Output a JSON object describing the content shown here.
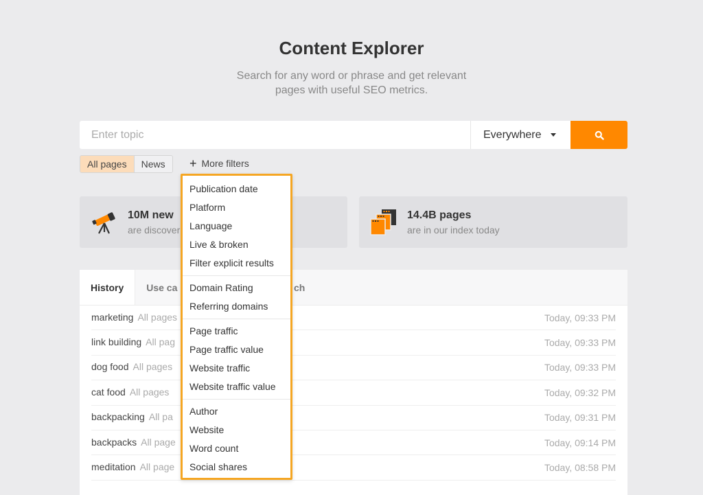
{
  "header": {
    "title": "Content Explorer",
    "subtitle_line1": "Search for any word or phrase and get relevant",
    "subtitle_line2": "pages with useful SEO metrics."
  },
  "search": {
    "placeholder": "Enter topic",
    "scope": "Everywhere",
    "button_icon": "search-icon",
    "button_color": "#ff8800"
  },
  "page_tabs": [
    "All pages",
    "News"
  ],
  "more_filters_label": "More filters",
  "stats": {
    "left": {
      "title": "10M new",
      "subtitle": "are discover",
      "icon": "telescope-icon"
    },
    "right": {
      "title": "14.4B pages",
      "subtitle": "are in our index today",
      "icon": "pages-stack-icon"
    }
  },
  "history": {
    "tabs": [
      "History",
      "Use ca",
      "ch"
    ],
    "rows": [
      {
        "query": "marketing",
        "scope": "All pages",
        "time": "Today, 09:33 PM"
      },
      {
        "query": "link building",
        "scope": "All pag",
        "time": "Today, 09:33 PM"
      },
      {
        "query": "dog food",
        "scope": "All pages",
        "time": "Today, 09:33 PM"
      },
      {
        "query": "cat food",
        "scope": "All pages",
        "time": "Today, 09:32 PM"
      },
      {
        "query": "backpacking",
        "scope": "All pa",
        "time": "Today, 09:31 PM"
      },
      {
        "query": "backpacks",
        "scope": "All page",
        "time": "Today, 09:14 PM"
      },
      {
        "query": "meditation",
        "scope": "All page",
        "time": "Today, 08:58 PM"
      }
    ]
  },
  "filters_menu": {
    "group1": [
      "Publication date",
      "Platform",
      "Language",
      "Live & broken",
      "Filter explicit results"
    ],
    "group2": [
      "Domain Rating",
      "Referring domains"
    ],
    "group3": [
      "Page traffic",
      "Page traffic value",
      "Website traffic",
      "Website traffic value"
    ],
    "group4": [
      "Author",
      "Website",
      "Word count",
      "Social shares"
    ],
    "highlight_color": "#f5a623"
  }
}
